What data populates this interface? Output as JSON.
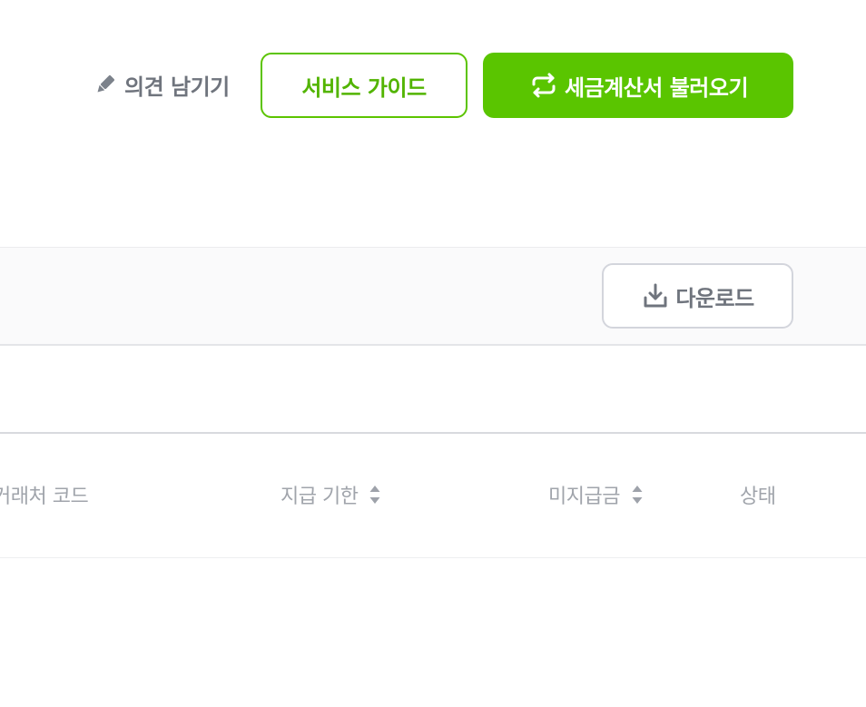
{
  "header": {
    "feedback_label": "의견 남기기",
    "feedback_icon": "pencil-icon",
    "guide_label": "서비스 가이드",
    "import_label": "세금계산서 불러오기",
    "import_icon": "sync-icon"
  },
  "toolbar": {
    "download_label": "다운로드",
    "download_icon": "download-icon"
  },
  "table": {
    "columns": [
      {
        "label": "거래처 코드",
        "sortable": false
      },
      {
        "label": "지급 기한",
        "sortable": true
      },
      {
        "label": "미지급금",
        "sortable": true
      },
      {
        "label": "상태",
        "sortable": false
      }
    ]
  },
  "colors": {
    "accent": "#5ac500",
    "text_muted": "#6f747d",
    "header_text": "#a0a4ab"
  }
}
